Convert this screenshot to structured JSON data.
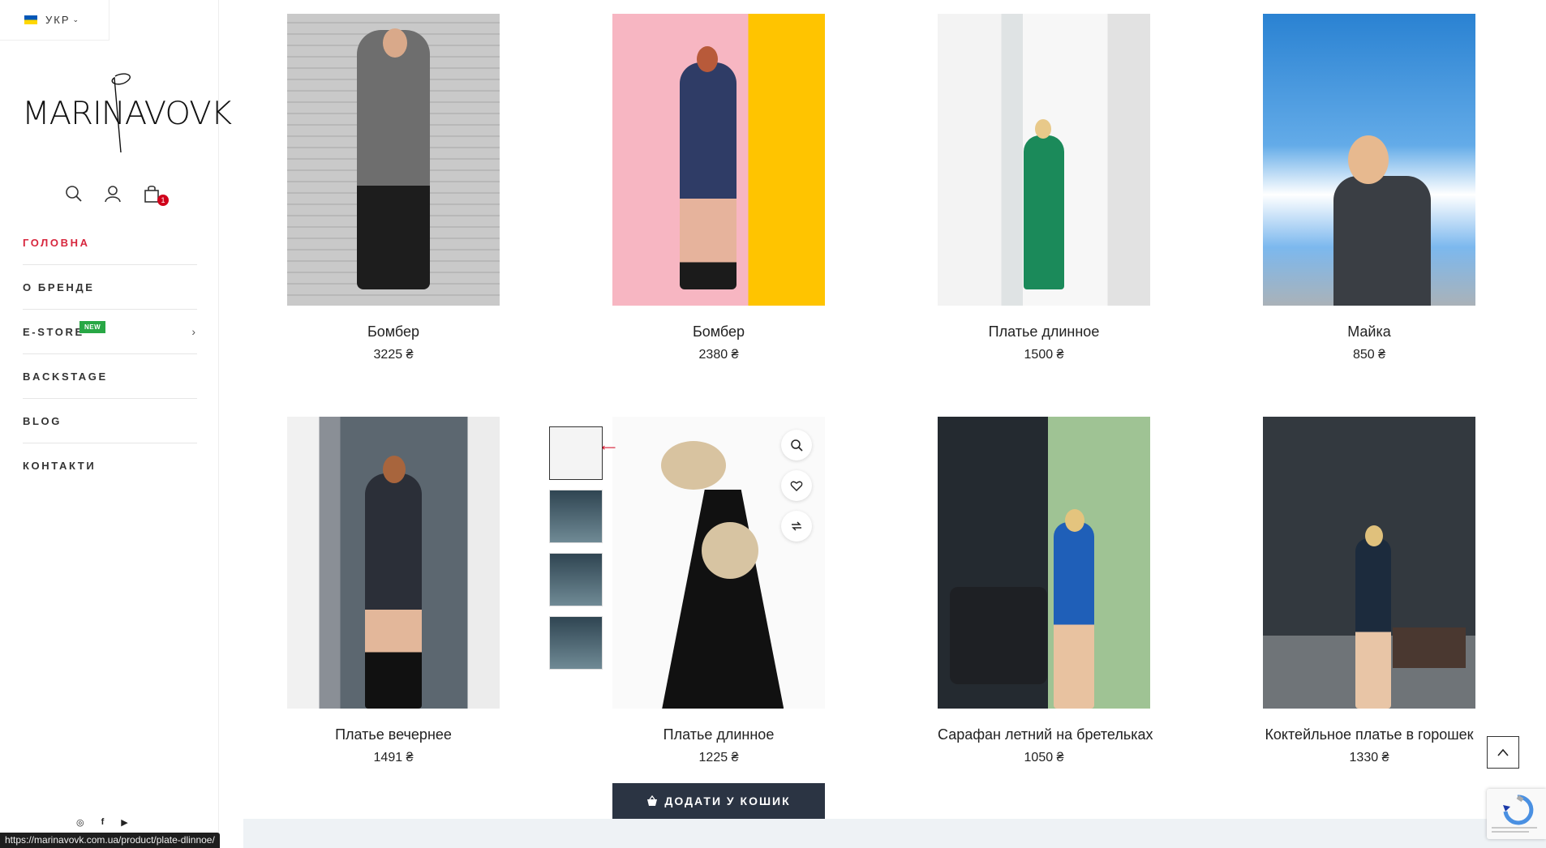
{
  "language": {
    "label": "УКР",
    "flag_colors": [
      "#0057b7",
      "#ffd700"
    ]
  },
  "logo": {
    "text": "MARINAVOVK"
  },
  "header_icons": [
    {
      "icon": "search-icon"
    },
    {
      "icon": "user-icon"
    },
    {
      "icon": "shopping-bag-icon",
      "badge": "1"
    }
  ],
  "nav": {
    "items": [
      {
        "label": "ГОЛОВНА",
        "active": true
      },
      {
        "label": "О БРЕНДЕ"
      },
      {
        "label": "E-STORE",
        "badge": "NEW",
        "arrow": "›"
      },
      {
        "label": "BACKSTAGE"
      },
      {
        "label": "BLOG"
      },
      {
        "label": "КОНТАКТИ"
      }
    ]
  },
  "social": [
    "instagram-icon",
    "facebook-icon",
    "youtube-icon"
  ],
  "social_glyphs": {
    "instagram": "◎",
    "facebook": "f",
    "youtube": "▶"
  },
  "status_url": "https://marinavovk.com.ua/product/plate-dlinnoe/",
  "products": [
    {
      "name": "Бомбер",
      "price": "3225 ₴"
    },
    {
      "name": "Бомбер",
      "price": "2380 ₴"
    },
    {
      "name": "Платье длинное",
      "price": "1500 ₴"
    },
    {
      "name": "Майка",
      "price": "850 ₴"
    },
    {
      "name": "Платье вечернее",
      "price": "1491 ₴"
    },
    {
      "name": "Платье длинное",
      "price": "1225 ₴"
    },
    {
      "name": "Сарафан летний на бретельках",
      "price": "1050 ₴"
    },
    {
      "name": "Коктейльное платье в горошек",
      "price": "1330 ₴"
    }
  ],
  "hover_actions": [
    "search-icon",
    "heart-icon",
    "compare-icon"
  ],
  "thumbnails_count": 4,
  "add_to_cart": {
    "label": "ДОДАТИ У КОШИК"
  },
  "colors": {
    "accent": "#d7263d",
    "new_badge": "#28a745",
    "cart_button": "#2b3443",
    "cart_badge": "#d0021b"
  }
}
